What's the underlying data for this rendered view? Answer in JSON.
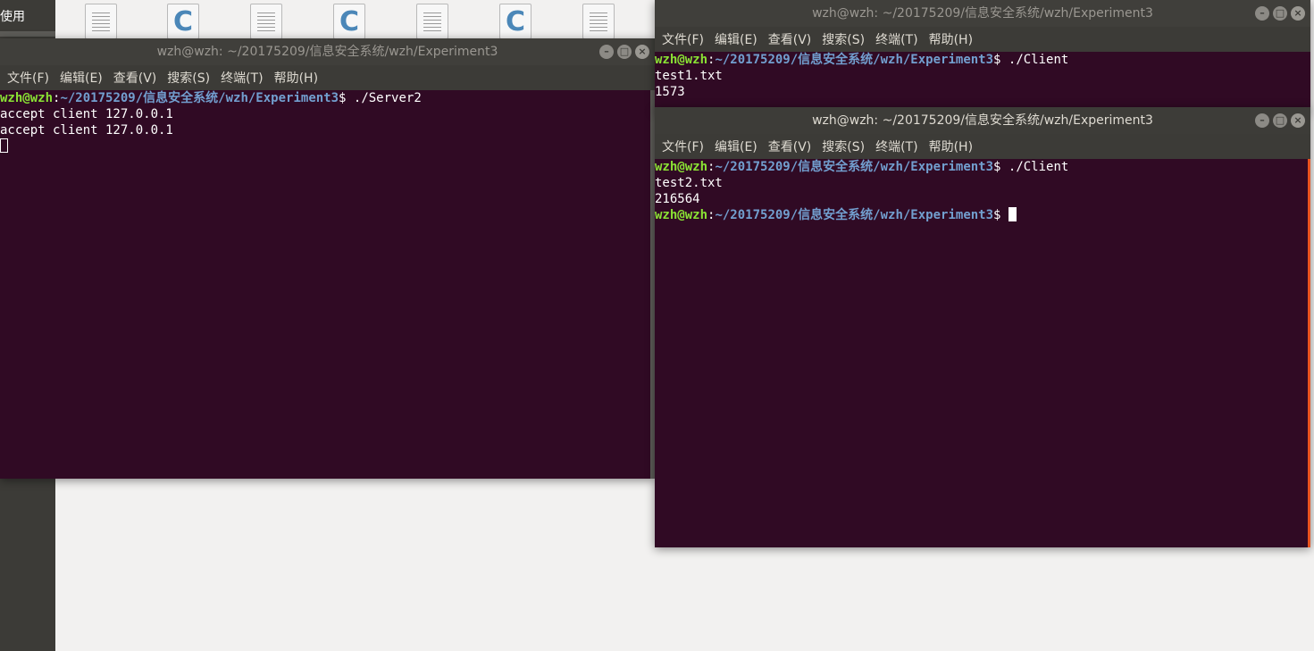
{
  "file_manager": {
    "sidebar_label": "使用",
    "icons": [
      "text-file-icon",
      "c-source-file-icon",
      "text-file-icon",
      "c-source-file-icon",
      "text-file-icon",
      "c-source-file-icon",
      "text-file-icon"
    ],
    "c_glyph": "C"
  },
  "menu": [
    "文件(F)",
    "编辑(E)",
    "查看(V)",
    "搜索(S)",
    "终端(T)",
    "帮助(H)"
  ],
  "window_buttons": {
    "minimize": "–",
    "maximize": "□",
    "close": "×"
  },
  "server_window": {
    "title": "wzh@wzh: ~/20175209/信息安全系统/wzh/Experiment3",
    "prompt_user": "wzh@wzh",
    "prompt_path": "~/20175209/信息安全系统/wzh/Experiment3",
    "command": " ./Server2",
    "output": [
      "accept client 127.0.0.1",
      "accept client 127.0.0.1"
    ]
  },
  "client1_window": {
    "title": "wzh@wzh: ~/20175209/信息安全系统/wzh/Experiment3",
    "prompt_user": "wzh@wzh",
    "prompt_path": "~/20175209/信息安全系统/wzh/Experiment3",
    "command": " ./Client",
    "output": [
      "test1.txt",
      "1573"
    ]
  },
  "client2_window": {
    "title": "wzh@wzh: ~/20175209/信息安全系统/wzh/Experiment3",
    "prompt_user": "wzh@wzh",
    "prompt_path": "~/20175209/信息安全系统/wzh/Experiment3",
    "command": " ./Client",
    "output": [
      "test2.txt",
      "216564"
    ]
  },
  "prompt_symbol": "$",
  "colors": {
    "terminal_bg": "#300a24",
    "prompt_user": "#8ae234",
    "prompt_path": "#729fcf",
    "chrome": "#3c3b37",
    "accent": "#e9541f"
  }
}
